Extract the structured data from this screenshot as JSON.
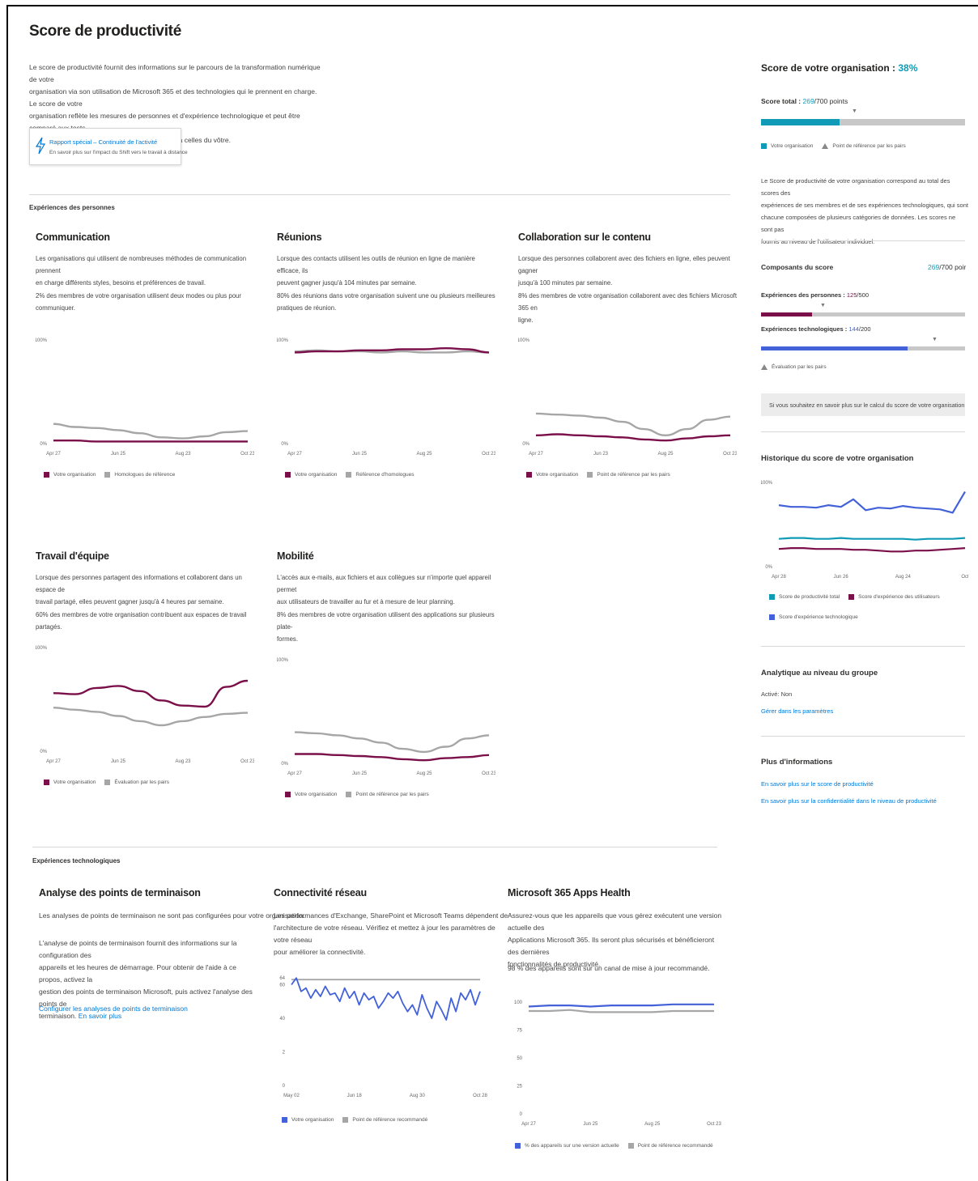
{
  "page": {
    "title": "Score de productivité",
    "intro": [
      "Le score de productivité fournit des informations sur le parcours de la transformation numérique de votre",
      "organisation via son utilisation de Microsoft 365 et des technologies qui le prennent en charge. Le score de votre",
      "organisation reflète les mesures de personnes et d'expérience technologique et peut être comparé aux tests",
      "d'évaluation provenant d'organisations similaires à celles du vôtre."
    ],
    "report_card": {
      "icon": "lightning-icon",
      "title": "Rapport spécial – Continuité de l'activité",
      "subtitle": "En savoir plus sur l'impact du Shift vers le travail à distance"
    }
  },
  "people_section": {
    "label": "Expériences des personnes",
    "cards": [
      {
        "title": "Communication",
        "desc": [
          "Les organisations qui utilisent de nombreuses méthodes de communication prennent",
          "en charge différents styles, besoins et préférences de travail."
        ],
        "stat": [
          "2% des membres de votre organisation utilisent deux modes ou plus pour",
          "communiquer."
        ],
        "y_top": "100%",
        "y_bottom": "0%",
        "x_ticks": [
          "Apr 27",
          "Jun 25",
          "Aug 23",
          "Oct 23"
        ],
        "legend": [
          "Votre organisation",
          "Homologues de référence"
        ]
      },
      {
        "title": "Réunions",
        "desc": [
          "Lorsque des contacts utilisent les outils de réunion en ligne de manière efficace, ils",
          "peuvent gagner jusqu'à 104 minutes par semaine."
        ],
        "stat": [
          "80% des réunions dans votre organisation suivent une ou plusieurs meilleures",
          "pratiques de réunion."
        ],
        "y_top": "100%",
        "y_bottom": "0%",
        "x_ticks": [
          "Apr 27",
          "Jun 25",
          "Aug 25",
          "Oct 23"
        ],
        "legend": [
          "Votre organisation",
          "Référence d'homologues"
        ]
      },
      {
        "title": "Collaboration sur le contenu",
        "desc": [
          "Lorsque des personnes collaborent avec des fichiers en ligne, elles peuvent gagner",
          "jusqu'à 100 minutes par semaine."
        ],
        "stat": [
          "8% des membres de votre organisation collaborent avec des fichiers Microsoft 365 en",
          "ligne."
        ],
        "y_top": "100%",
        "y_bottom": "0%",
        "x_ticks": [
          "Apr 27",
          "Jun 23",
          "Aug 25",
          "Oct 23"
        ],
        "legend": [
          "Votre organisation",
          "Point de référence par les pairs"
        ]
      },
      {
        "title": "Travail d'équipe",
        "desc": [
          "Lorsque des personnes partagent des informations et collaborent dans un espace de",
          "travail partagé, elles peuvent gagner jusqu'à 4 heures par semaine."
        ],
        "stat": [
          "60% des membres de votre organisation contribuent aux espaces de travail partagés.",
          ""
        ],
        "y_top": "100%",
        "y_bottom": "0%",
        "x_ticks": [
          "Apr 27",
          "Jun 25",
          "Aug 23",
          "Oct 23"
        ],
        "legend": [
          "Votre organisation",
          "Évaluation par les pairs"
        ]
      },
      {
        "title": "Mobilité",
        "desc": [
          "L'accès aux e-mails, aux fichiers et aux collègues sur n'importe quel appareil permet",
          "aux utilisateurs de travailler au fur et à mesure de leur planning."
        ],
        "stat": [
          "8% des membres de votre organisation utilisent des applications sur plusieurs plate-",
          "formes."
        ],
        "y_top": "100%",
        "y_bottom": "0%",
        "x_ticks": [
          "Apr 27",
          "Jun 25",
          "Aug 25",
          "Oct 23"
        ],
        "legend": [
          "Votre organisation",
          "Point de référence par les pairs"
        ]
      }
    ]
  },
  "tech_section": {
    "label": "Expériences technologiques",
    "endpoint": {
      "title": "Analyse des points de terminaison",
      "line1": "Les analyses de points de terminaison ne sont pas configurées pour votre organisation.",
      "para": [
        "L'analyse de points de terminaison fournit des informations sur la configuration des",
        "appareils et les heures de démarrage. Pour obtenir de l'aide à ce propos, activez la",
        "gestion des points de terminaison Microsoft, puis activez l'analyse des points de",
        "terminaison."
      ],
      "learn_more": "En savoir plus",
      "configure_link": "Configurer les analyses de points de terminaison"
    },
    "network": {
      "title": "Connectivité réseau",
      "desc": [
        "Les performances d'Exchange, SharePoint et Microsoft Teams dépendent de",
        "l'architecture de votre réseau. Vérifiez et mettez à jour les paramètres de votre réseau",
        "pour améliorer la connectivité."
      ],
      "y_ticks": [
        "0",
        "2",
        "40",
        "60",
        "64"
      ],
      "x_ticks": [
        "May 02",
        "Jun 18",
        "Aug 30",
        "Oct 28"
      ],
      "legend": [
        "Votre organisation",
        "Point de référence recommandé"
      ]
    },
    "apps": {
      "title": "Microsoft 365 Apps Health",
      "desc": [
        "Assurez-vous que les appareils que vous gérez exécutent une version actuelle des",
        "Applications Microsoft 365. Ils seront plus sécurisés et bénéficieront des dernières",
        "fonctionnalités de productivité."
      ],
      "stat": "98 % des appareils sont sur un canal de mise à jour recommandé.",
      "y_ticks": [
        "100",
        "75",
        "50",
        "25",
        "0"
      ],
      "x_ticks": [
        "Apr 27",
        "Jun 25",
        "Aug 25",
        "Oct 23"
      ],
      "legend": [
        "% des appareils sur une version actuelle",
        "Point de référence recommandé"
      ]
    }
  },
  "sidebar": {
    "org_score_label": "Score de votre organisation : ",
    "org_score_value": "38%",
    "total_label": "Score total : ",
    "total_value": "269",
    "total_suffix": "/700 points",
    "total_fraction": 0.384,
    "legend": [
      "Votre organisation",
      "Point de référence par les pairs"
    ],
    "explain": [
      "Le Score de productivité de votre organisation correspond au total des scores des",
      "expériences de ses membres et de ses expériences technologiques, qui sont",
      "chacune composées de plusieurs catégories de données. Les scores ne sont pas",
      "fournis au niveau de l'utilisateur individuel."
    ],
    "components_label": "Composants du score",
    "components_value": "269",
    "components_suffix": "/700 poir",
    "people_label": "Expériences des personnes : ",
    "people_value": "125",
    "people_suffix": "/500",
    "people_fraction": 0.25,
    "tech_label": "Expériences technologiques : ",
    "tech_value": "144",
    "tech_suffix": "/200",
    "tech_fraction": 0.72,
    "peer_eval": "Évaluation par les pairs",
    "more_calc": "Si vous souhaitez en savoir plus sur le calcul du score de votre organisation",
    "history_title": "Historique du score de votre organisation",
    "history_y_top": "100%",
    "history_y_bottom": "0%",
    "history_x": [
      "Apr 28",
      "Jun 26",
      "Aug 24",
      "Oct"
    ],
    "history_legend": [
      "Score de productivité total",
      "Score d'expérience des utilisateurs",
      "Score d'expérience technologique"
    ],
    "group_title": "Analytique au niveau du groupe",
    "group_status": "Activé: Non",
    "group_link": "Gérer dans les paramètres",
    "more_title": "Plus d'informations",
    "more_links": [
      "En savoir plus sur le score de productivité",
      "En savoir plus sur la confidentialité dans le niveau de productivité"
    ]
  },
  "colors": {
    "org": "#7a0f4a",
    "peer": "#a6a6a6",
    "teal": "#0f9bb5",
    "blue": "#4361d8",
    "link": "#0078d4"
  },
  "chart_data": [
    {
      "type": "line",
      "name": "Communication",
      "x": [
        "Apr 27",
        "Jun 25",
        "Aug 23",
        "Oct 23"
      ],
      "ylim": [
        0,
        100
      ],
      "series": [
        {
          "name": "Votre organisation",
          "values": [
            3,
            3,
            2,
            2,
            2,
            2,
            2,
            2,
            2,
            2
          ]
        },
        {
          "name": "Homologues de référence",
          "values": [
            19,
            16,
            15,
            13,
            10,
            6,
            5,
            7,
            11,
            12
          ]
        }
      ]
    },
    {
      "type": "line",
      "name": "Réunions",
      "x": [
        "Apr 27",
        "Jun 25",
        "Aug 25",
        "Oct 23"
      ],
      "ylim": [
        0,
        100
      ],
      "series": [
        {
          "name": "Votre organisation",
          "values": [
            88,
            89,
            89,
            90,
            90,
            91,
            91,
            92,
            91,
            88
          ]
        },
        {
          "name": "Référence d'homologues",
          "values": [
            89,
            90,
            89,
            89,
            88,
            89,
            88,
            88,
            89,
            88
          ]
        }
      ]
    },
    {
      "type": "line",
      "name": "Collaboration sur le contenu",
      "x": [
        "Apr 27",
        "Jun 23",
        "Aug 25",
        "Oct 23"
      ],
      "ylim": [
        0,
        100
      ],
      "series": [
        {
          "name": "Votre organisation",
          "values": [
            8,
            9,
            8,
            7,
            6,
            4,
            3,
            5,
            7,
            8
          ]
        },
        {
          "name": "Point de référence par les pairs",
          "values": [
            29,
            28,
            27,
            25,
            21,
            14,
            8,
            14,
            23,
            26
          ]
        }
      ]
    },
    {
      "type": "line",
      "name": "Travail d'équipe",
      "x": [
        "Apr 27",
        "Jun 25",
        "Aug 23",
        "Oct 23"
      ],
      "ylim": [
        0,
        100
      ],
      "series": [
        {
          "name": "Votre organisation",
          "values": [
            56,
            55,
            61,
            63,
            58,
            49,
            44,
            43,
            62,
            68
          ]
        },
        {
          "name": "Évaluation par les pairs",
          "values": [
            42,
            40,
            38,
            34,
            29,
            25,
            29,
            33,
            36,
            37
          ]
        }
      ]
    },
    {
      "type": "line",
      "name": "Mobilité",
      "x": [
        "Apr 27",
        "Jun 25",
        "Aug 25",
        "Oct 23"
      ],
      "ylim": [
        0,
        100
      ],
      "series": [
        {
          "name": "Votre organisation",
          "values": [
            9,
            9,
            8,
            7,
            6,
            4,
            3,
            5,
            6,
            8
          ]
        },
        {
          "name": "Point de référence par les pairs",
          "values": [
            30,
            29,
            27,
            24,
            20,
            14,
            11,
            16,
            24,
            27
          ]
        }
      ]
    },
    {
      "type": "line",
      "name": "Connectivité réseau",
      "x": [
        "May 02",
        "Jun 18",
        "Aug 30",
        "Oct 28"
      ],
      "y_ticks": [
        0,
        2,
        40,
        60,
        64
      ],
      "series": [
        {
          "name": "Votre organisation",
          "values": [
            60,
            64,
            56,
            58,
            52,
            57,
            53,
            59,
            54,
            55,
            50,
            58,
            52,
            56,
            48,
            55,
            51,
            53,
            46,
            50,
            55,
            52,
            56,
            49,
            44,
            48,
            42,
            54,
            46,
            40,
            50,
            45,
            39,
            52,
            44,
            55,
            51,
            57,
            48,
            56
          ]
        },
        {
          "name": "Point de référence recommandé",
          "values": [
            63,
            63,
            63,
            63,
            63,
            63,
            63,
            63,
            63,
            63,
            63,
            63,
            63,
            63,
            63,
            63,
            63,
            63,
            63,
            63,
            63,
            63,
            63,
            63,
            63,
            63,
            63,
            63,
            63,
            63,
            63,
            63,
            63,
            63,
            63,
            63,
            63,
            63,
            63,
            63
          ]
        }
      ]
    },
    {
      "type": "line",
      "name": "Microsoft 365 Apps Health",
      "x": [
        "Apr 27",
        "Jun 25",
        "Aug 25",
        "Oct 23"
      ],
      "y_ticks": [
        0,
        25,
        50,
        75,
        100
      ],
      "series": [
        {
          "name": "% des appareils sur une version actuelle",
          "values": [
            96,
            97,
            97,
            96,
            97,
            97,
            97,
            98,
            98,
            98
          ]
        },
        {
          "name": "Point de référence recommandé",
          "values": [
            92,
            92,
            93,
            91,
            91,
            91,
            91,
            92,
            92,
            92
          ]
        }
      ]
    },
    {
      "type": "line",
      "name": "Historique du score de votre organisation",
      "x": [
        "Apr 28",
        "Jun 26",
        "Aug 24",
        "Oct"
      ],
      "ylim": [
        0,
        100
      ],
      "series": [
        {
          "name": "Score de productivité total",
          "values": [
            33,
            34,
            34,
            33,
            33,
            34,
            33,
            33,
            33,
            33,
            33,
            32,
            33,
            33,
            33,
            34
          ]
        },
        {
          "name": "Score d'expérience des utilisateurs",
          "values": [
            21,
            22,
            22,
            21,
            21,
            21,
            20,
            20,
            19,
            18,
            18,
            19,
            19,
            20,
            21,
            22
          ]
        },
        {
          "name": "Score d'expérience technologique",
          "values": [
            73,
            71,
            71,
            70,
            73,
            71,
            80,
            67,
            70,
            69,
            72,
            70,
            69,
            68,
            64,
            89
          ]
        }
      ]
    }
  ]
}
